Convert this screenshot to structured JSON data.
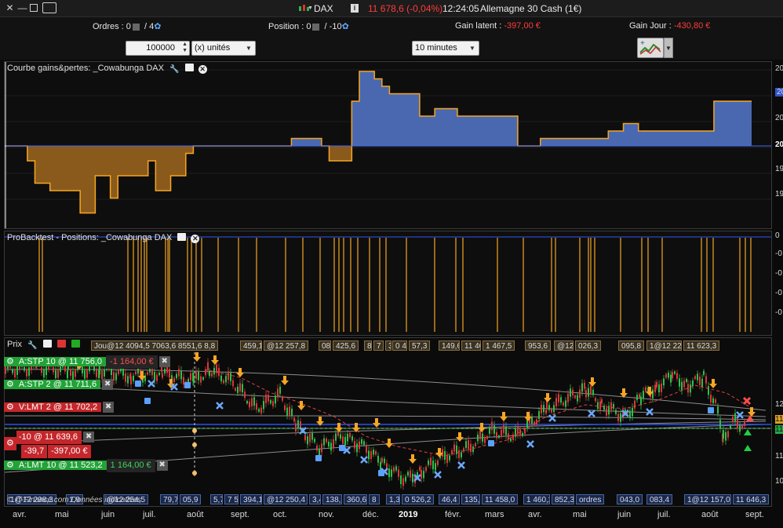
{
  "titlebar": {
    "instrument": "DAX",
    "change": "11 678,6 (-0,04%)",
    "time": "12:24:05",
    "market": "Allemagne 30 Cash (1€)"
  },
  "infobar": {
    "orders_label": "Ordres :",
    "orders_value": "0",
    "orders_count": "4",
    "position_label": "Position :",
    "position_value": "0",
    "position_count": "-10",
    "latent_label": "Gain latent :",
    "latent_value": "-397,00 €",
    "day_label": "Gain Jour :",
    "day_value": "-430,80 €"
  },
  "toolbar": {
    "quantity": "100000",
    "unit": "(x) unités",
    "timeframe": "10 minutes"
  },
  "panels": {
    "equity_title": "Courbe gains&pertes: _Cowabunga DAX",
    "positions_title": "ProBacktest - Positions: _Cowabunga DAX",
    "price_title": "Prix",
    "equity_ticks": [
      "20",
      "20",
      "20",
      "20",
      "19",
      "19"
    ],
    "positions_ticks": [
      "0",
      "-0",
      "-0",
      "-0",
      "-0"
    ]
  },
  "price_labels_top": [
    "Jou@12 4094,5 7063,6 8551,6 8,8",
    "459,1",
    "@12 257,8",
    "088,6",
    "425,6",
    "8",
    "7 2,9",
    "3",
    "0 476,2",
    "57,3",
    "149,6",
    "11 408,0",
    "1 467,5",
    "953,6",
    "@12 207,2",
    "026,3",
    "095,8",
    "1@12 222,0",
    "11 623,3"
  ],
  "price_labels_bottom": [
    "1@12 298,3",
    "1,9",
    "@12 254,5",
    "79,7",
    "05,9",
    "5,7",
    "7 5",
    "394,1",
    "@12 250,4",
    "3,4",
    "138,6",
    "360,6",
    "8",
    "1,3",
    "0 526,2",
    "46,4",
    "135,9",
    "11 458,0",
    "1 460,2",
    "852,3",
    "ordres",
    "043,0",
    "083,4",
    "1@12 157,0",
    "11 646,3"
  ],
  "watermark": "© IT-Finance.com Données indicatives",
  "orders": [
    {
      "label": "A:STP  10 @ 11 756,0",
      "value": "-1 164,00 €",
      "color": "green"
    },
    {
      "label": "A:STP  2 @ 11 711,6",
      "value": "",
      "color": "green"
    },
    {
      "label": "V:LMT  2 @ 11 702,2",
      "value": "",
      "color": "red"
    },
    {
      "label": "-10 @ 11 639,6",
      "value": "",
      "color": "red"
    },
    {
      "label": "-39,7",
      "value": "-397,00 €",
      "color": "red"
    },
    {
      "label": "A:LMT  10 @ 11 523,2",
      "value": "1 164,00 €",
      "color": "green"
    }
  ],
  "right_price_ticks": [
    "12",
    "11",
    "11",
    "11",
    "10"
  ],
  "x_axis": {
    "months": [
      "avr.",
      "mai",
      "juin",
      "juil.",
      "août",
      "sept.",
      "oct.",
      "nov.",
      "déc.",
      "2019",
      "févr.",
      "mars",
      "avr.",
      "mai",
      "juin",
      "juil.",
      "août",
      "sept."
    ]
  },
  "colors": {
    "profit": "#4a68b0",
    "loss": "#8a5a1c",
    "equity_line": "#f5a623",
    "baseline": "#4466ff",
    "position_bar": "#f5a623"
  },
  "chart_data": {
    "type": "area",
    "title": "Courbe gains&pertes: _Cowabunga DAX",
    "series": [
      {
        "values": [
          0,
          0,
          0,
          -2,
          -5,
          -5,
          -6,
          -6,
          -6,
          -6,
          -9,
          -9,
          -4,
          -4,
          -7,
          -4,
          -4,
          -4,
          -4,
          -2,
          -6,
          -6,
          -4,
          -4,
          -1,
          0,
          0,
          0,
          0,
          0,
          0,
          0,
          0,
          0,
          0,
          0,
          0,
          0,
          1,
          1,
          1,
          1,
          0,
          -2,
          -2,
          -2,
          6,
          10,
          10,
          9,
          8,
          7,
          7,
          7,
          7,
          4,
          4,
          5,
          5,
          5,
          4,
          4,
          4,
          4,
          4,
          4,
          4,
          4,
          0,
          0,
          0,
          1,
          1,
          1,
          1,
          1,
          1,
          1,
          1,
          1,
          2,
          2,
          3,
          3,
          2,
          2,
          2,
          2,
          2,
          2,
          2,
          2,
          2,
          2,
          6,
          6,
          6,
          6,
          6,
          6
        ]
      }
    ]
  }
}
